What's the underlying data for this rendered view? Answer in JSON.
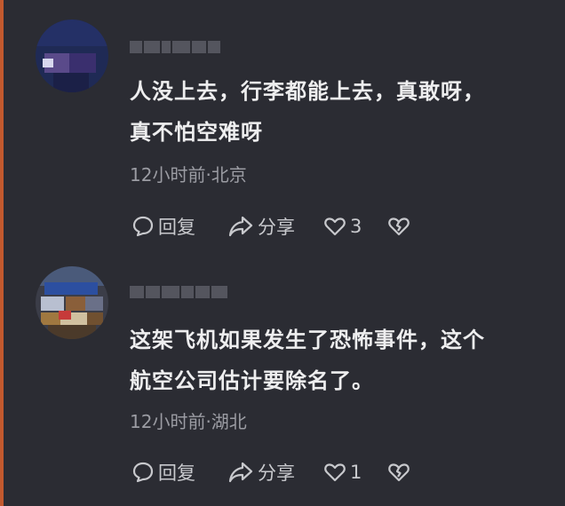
{
  "comments": [
    {
      "text_line1": "人没上去，行李都能上去，真敢呀，",
      "text_line2": "真不怕空难呀",
      "meta": "12小时前·北京",
      "reply_label": "回复",
      "share_label": "分享",
      "like_count": "3"
    },
    {
      "text_line1": "这架飞机如果发生了恐怖事件，这个",
      "text_line2": "航空公司估计要除名了。",
      "meta": "12小时前·湖北",
      "reply_label": "回复",
      "share_label": "分享",
      "like_count": "1"
    }
  ],
  "colors": {
    "background": "#2b2c33",
    "text": "#eeeeef",
    "meta": "#9b9ca3",
    "action": "#c8c9cd",
    "left_edge": "#c2592e"
  },
  "icons": [
    "reply-bubble-icon",
    "share-arrow-icon",
    "heart-icon",
    "broken-heart-icon"
  ]
}
